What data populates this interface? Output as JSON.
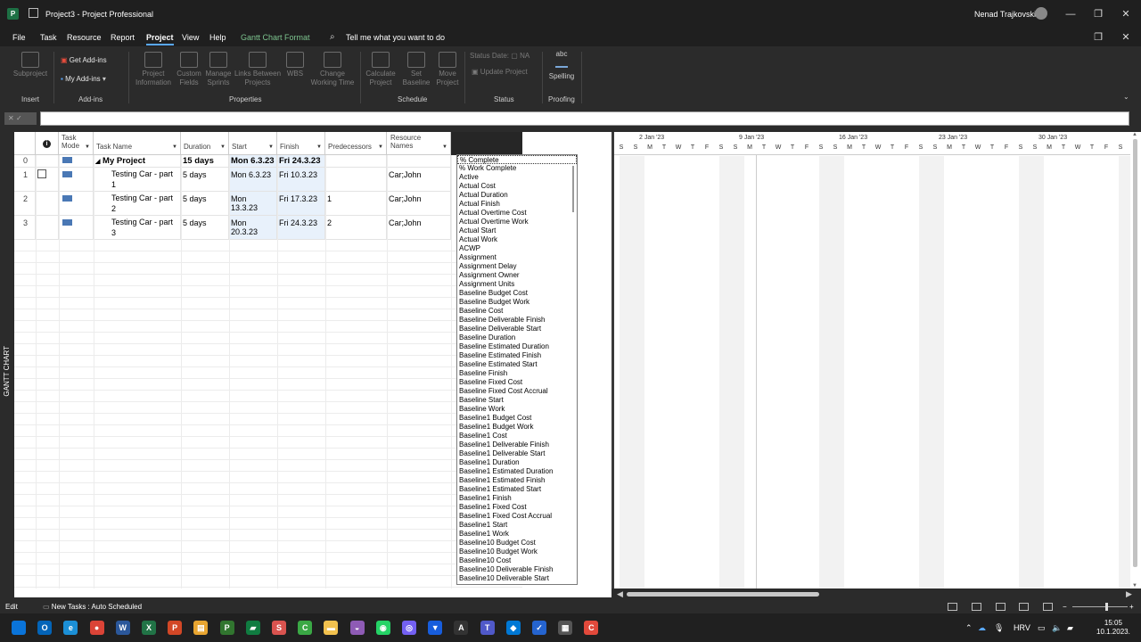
{
  "title": {
    "app_icon": "P",
    "text": "Project3  -  Project Professional",
    "user": "Nenad Trajkovski"
  },
  "window_controls": {
    "minimize": "—",
    "restore": "❐",
    "close": "✕",
    "ribbon_restore": "❐",
    "ribbon_close": "✕"
  },
  "menu": {
    "tabs": [
      "File",
      "Task",
      "Resource",
      "Report",
      "Project",
      "View",
      "Help",
      "Gantt Chart Format"
    ],
    "active": "Project",
    "tell_me": "Tell me what you want to do"
  },
  "ribbon": {
    "subproject": "Subproject",
    "get_addins": "Get Add-ins",
    "my_addins": "My Add-ins",
    "project_information": [
      "Project",
      "Information"
    ],
    "custom_fields": [
      "Custom",
      "Fields"
    ],
    "manage_sprints": [
      "Manage",
      "Sprints"
    ],
    "links_between_projects": [
      "Links Between",
      "Projects"
    ],
    "wbs": "WBS",
    "change_working_time": [
      "Change",
      "Working Time"
    ],
    "calculate_project": [
      "Calculate",
      "Project"
    ],
    "set_baseline": [
      "Set",
      "Baseline"
    ],
    "move_project": [
      "Move",
      "Project"
    ],
    "status_date": "Status Date:",
    "status_date_value": "NA",
    "update_project": "Update Project",
    "spelling_abc": "abc",
    "spelling": "Spelling",
    "groups": [
      "Insert",
      "Add-ins",
      "Properties",
      "Schedule",
      "Status",
      "Proofing"
    ]
  },
  "formula": {
    "cancel": "✕",
    "enter": "✓"
  },
  "side_label": "GANTT CHART",
  "columns": {
    "info": "i",
    "task_mode": [
      "Task",
      "Mode"
    ],
    "task_name": "Task Name",
    "duration": "Duration",
    "start": "Start",
    "finish": "Finish",
    "predecessors": "Predecessors",
    "resource_names": [
      "Resource",
      "Names"
    ]
  },
  "rows": [
    {
      "id": "0",
      "name": "My Project",
      "duration": "15 days",
      "start": "Mon 6.3.23",
      "finish": "Fri 24.3.23",
      "pred": "",
      "res": ""
    },
    {
      "id": "1",
      "name": [
        "Testing Car - part",
        "1"
      ],
      "duration": "5 days",
      "start": "Mon 6.3.23",
      "finish": "Fri 10.3.23",
      "pred": "",
      "res": "Car;John"
    },
    {
      "id": "2",
      "name": [
        "Testing Car - part",
        "2"
      ],
      "duration": "5 days",
      "start": "Mon 13.3.23",
      "finish": "Fri 17.3.23",
      "pred": "1",
      "res": "Car;John"
    },
    {
      "id": "3",
      "name": [
        "Testing Car - part",
        "3"
      ],
      "duration": "5 days",
      "start": "Mon 20.3.23",
      "finish": "Fri 24.3.23",
      "pred": "2",
      "res": "Car;John"
    }
  ],
  "field_list": [
    "% Complete",
    "% Work Complete",
    "Active",
    "Actual Cost",
    "Actual Duration",
    "Actual Finish",
    "Actual Overtime Cost",
    "Actual Overtime Work",
    "Actual Start",
    "Actual Work",
    "ACWP",
    "Assignment",
    "Assignment Delay",
    "Assignment Owner",
    "Assignment Units",
    "Baseline Budget Cost",
    "Baseline Budget Work",
    "Baseline Cost",
    "Baseline Deliverable Finish",
    "Baseline Deliverable Start",
    "Baseline Duration",
    "Baseline Estimated Duration",
    "Baseline Estimated Finish",
    "Baseline Estimated Start",
    "Baseline Finish",
    "Baseline Fixed Cost",
    "Baseline Fixed Cost Accrual",
    "Baseline Start",
    "Baseline Work",
    "Baseline1 Budget Cost",
    "Baseline1 Budget Work",
    "Baseline1 Cost",
    "Baseline1 Deliverable Finish",
    "Baseline1 Deliverable Start",
    "Baseline1 Duration",
    "Baseline1 Estimated Duration",
    "Baseline1 Estimated Finish",
    "Baseline1 Estimated Start",
    "Baseline1 Finish",
    "Baseline1 Fixed Cost",
    "Baseline1 Fixed Cost Accrual",
    "Baseline1 Start",
    "Baseline1 Work",
    "Baseline10 Budget Cost",
    "Baseline10 Budget Work",
    "Baseline10 Cost",
    "Baseline10 Deliverable Finish",
    "Baseline10 Deliverable Start"
  ],
  "timescale": {
    "weeks": [
      "2 Jan '23",
      "9 Jan '23",
      "16 Jan '23",
      "23 Jan '23",
      "30 Jan '23"
    ],
    "days": [
      "S",
      "S",
      "M",
      "T",
      "W",
      "T",
      "F",
      "S",
      "S",
      "M",
      "T",
      "W",
      "T",
      "F",
      "S",
      "S",
      "M",
      "T",
      "W",
      "T",
      "F",
      "S",
      "S",
      "M",
      "T",
      "W",
      "T",
      "F",
      "S",
      "S",
      "M",
      "T",
      "W",
      "T",
      "F",
      "S",
      "S"
    ]
  },
  "status": {
    "mode": "Edit",
    "new_tasks": "New Tasks : Auto Scheduled",
    "zoom_minus": "−",
    "zoom_plus": "+"
  },
  "taskbar": {
    "lang": "HRV",
    "time": "15:05",
    "date": "10.1.2023.",
    "apps": [
      {
        "icon": "windows-start-icon",
        "label": "",
        "color": "#0a74da"
      },
      {
        "icon": "outlook-icon",
        "label": "O",
        "color": "#0364b8"
      },
      {
        "icon": "edge-icon",
        "label": "e",
        "color": "#1b8fd6"
      },
      {
        "icon": "chrome-icon",
        "label": "●",
        "color": "#db4437"
      },
      {
        "icon": "word-icon",
        "label": "W",
        "color": "#2b579a"
      },
      {
        "icon": "excel-icon",
        "label": "X",
        "color": "#217346"
      },
      {
        "icon": "powerpoint-icon",
        "label": "P",
        "color": "#d24726"
      },
      {
        "icon": "files-icon",
        "label": "▤",
        "color": "#e8a530"
      },
      {
        "icon": "project-icon",
        "label": "P",
        "color": "#31752f"
      },
      {
        "icon": "planner-icon",
        "label": "▰",
        "color": "#107c41"
      },
      {
        "icon": "s-app-icon",
        "label": "S",
        "color": "#d9534f"
      },
      {
        "icon": "camtasia-icon",
        "label": "C",
        "color": "#3aa845"
      },
      {
        "icon": "folder-icon",
        "label": "▬",
        "color": "#f2c14e"
      },
      {
        "icon": "cloud-app-icon",
        "label": "◒",
        "color": "#8e5bb5"
      },
      {
        "icon": "whatsapp-icon",
        "label": "◉",
        "color": "#25d366"
      },
      {
        "icon": "viber-icon",
        "label": "◎",
        "color": "#7360f2"
      },
      {
        "icon": "bitwarden-icon",
        "label": "▼",
        "color": "#175ddc"
      },
      {
        "icon": "a-app-icon",
        "label": "A",
        "color": "#333333"
      },
      {
        "icon": "teams-icon",
        "label": "T",
        "color": "#5059c9"
      },
      {
        "icon": "vscode-icon",
        "label": "◆",
        "color": "#0078d4"
      },
      {
        "icon": "todo-icon",
        "label": "✓",
        "color": "#2564cf"
      },
      {
        "icon": "calculator-icon",
        "label": "▦",
        "color": "#555555"
      },
      {
        "icon": "c-app-icon",
        "label": "C",
        "color": "#e2493b"
      }
    ]
  },
  "colors": {
    "accent": "#5aa9ff",
    "ribbon_bg": "#2b2b2b",
    "title_bg": "#1f1f1f",
    "highlight": "#e8f1fb",
    "gantt_format": "#7dc48f"
  }
}
